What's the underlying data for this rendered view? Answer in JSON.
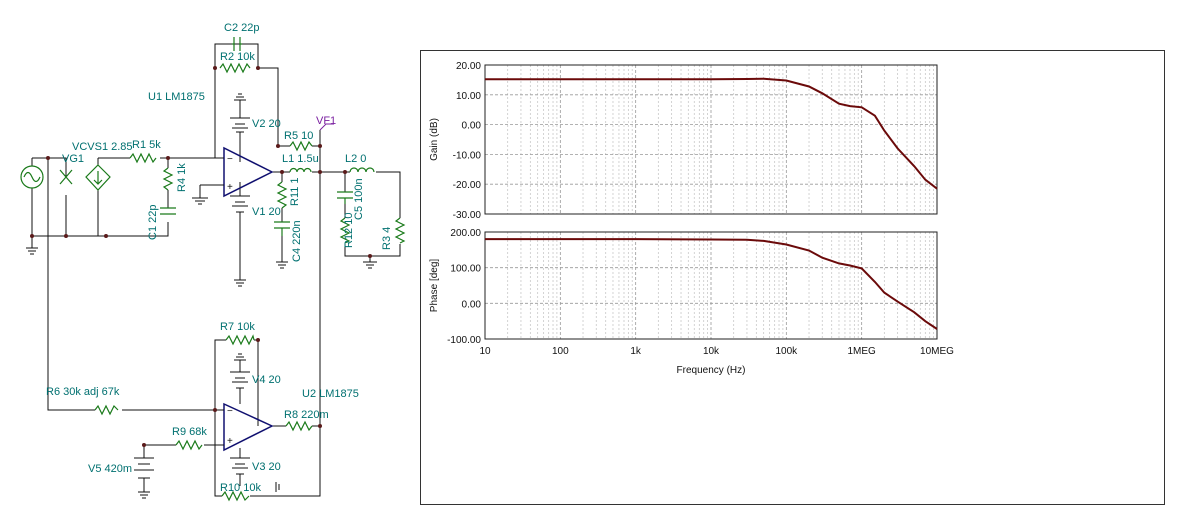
{
  "schematic": {
    "labels": {
      "c2": "C2 22p",
      "r2": "R2 10k",
      "u1": "U1 LM1875",
      "vcvs1": "VCVS1 2.85",
      "vg1": "VG1",
      "r1": "R1 5k",
      "r4": "R4 1k",
      "c1": "C1 22p",
      "v2": "V2 20",
      "v1": "V1 20",
      "r5": "R5 10",
      "vf1": "VF1",
      "l1": "L1 1.5u",
      "r11": "R11 1",
      "c4": "C4 220n",
      "l2": "L2 0",
      "c5": "C5 100n",
      "r12": "R12 10",
      "r3": "R3 4",
      "r7": "R7 10k",
      "v4": "V4 20",
      "r6": "R6 30k adj 67k",
      "u2": "U2 LM1875",
      "r8": "R8 220m",
      "r9": "R9 68k",
      "v5": "V5 420m",
      "v3": "V3 20",
      "r10": "R10 10k"
    }
  },
  "chart_data": {
    "type": "line",
    "xlabel": "Frequency (Hz)",
    "xscale": "log",
    "xlim": [
      10,
      10000000
    ],
    "xticks": [
      "10",
      "100",
      "1k",
      "10k",
      "100k",
      "1MEG",
      "10MEG"
    ],
    "panels": [
      {
        "ylabel": "Gain (dB)",
        "ylim": [
          -30,
          20
        ],
        "yticks": [
          "20.00",
          "10.00",
          "0.00",
          "-10.00",
          "-20.00",
          "-30.00"
        ],
        "color": "#6b0a0a",
        "series": [
          {
            "x": [
              10,
              100,
              1000,
              10000,
              30000,
              50000,
              100000,
              200000,
              300000,
              500000,
              700000,
              1000000,
              1500000,
              2000000,
              3000000,
              5000000,
              7000000,
              10000000
            ],
            "y": [
              15.2,
              15.2,
              15.2,
              15.2,
              15.3,
              15.4,
              14.8,
              12.8,
              10.5,
              7.0,
              6.2,
              5.8,
              3.0,
              -2.0,
              -8.0,
              -14.0,
              -18.5,
              -21.5
            ]
          }
        ]
      },
      {
        "ylabel": "Phase [deg]",
        "ylim": [
          -100,
          200
        ],
        "yticks": [
          "200.00",
          "100.00",
          "0.00",
          "-100.00"
        ],
        "color": "#6b0a0a",
        "series": [
          {
            "x": [
              10,
              100,
              1000,
              10000,
              30000,
              50000,
              100000,
              200000,
              300000,
              500000,
              700000,
              1000000,
              1500000,
              2000000,
              3000000,
              5000000,
              7000000,
              10000000
            ],
            "y": [
              180,
              180,
              180,
              179,
              178,
              175,
              165,
              148,
              128,
              112,
              106,
              98,
              60,
              30,
              5,
              -25,
              -50,
              -72
            ]
          }
        ]
      }
    ]
  }
}
